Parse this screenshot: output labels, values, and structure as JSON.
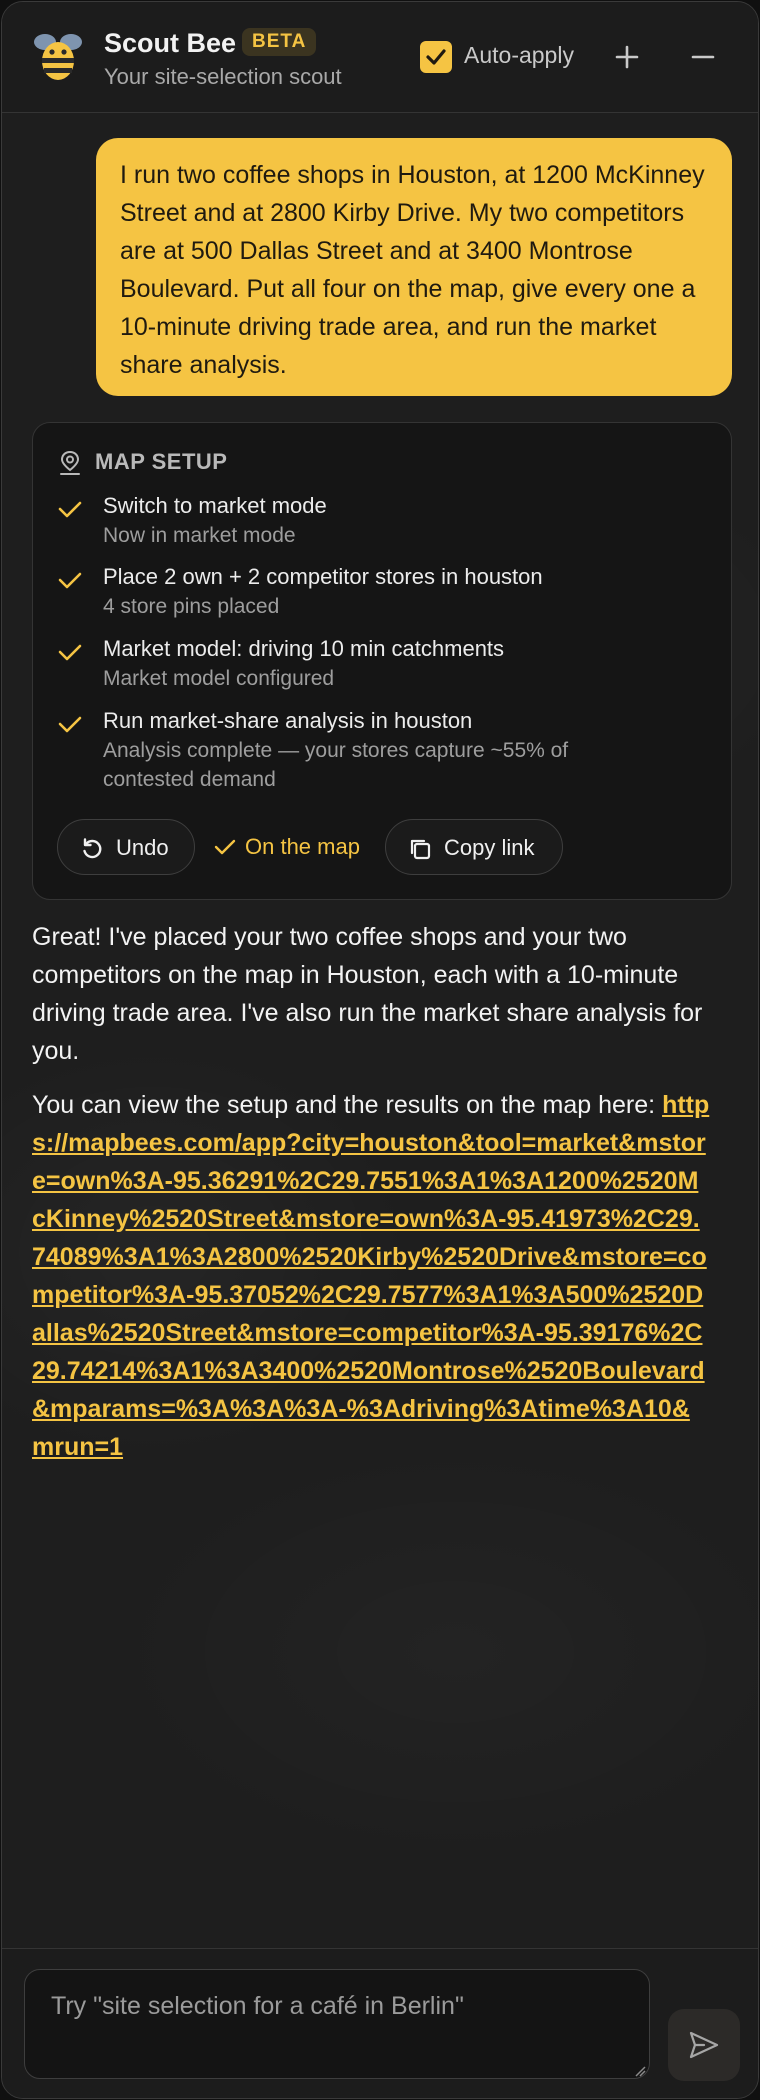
{
  "header": {
    "title": "Scout Bee",
    "badge": "BETA",
    "subtitle": "Your site-selection scout",
    "auto_apply_label": "Auto-apply",
    "auto_apply_checked": true,
    "icons": [
      "bee-logo-icon",
      "check-icon",
      "plus-icon",
      "minus-icon"
    ]
  },
  "conversation": {
    "user_message": "I run two coffee shops in Houston, at 1200 McKinney Street and at 2800 Kirby Drive. My two competitors are at 500 Dallas Street and at 3400 Montrose Boulevard. Put all four on the map, give every one a 10-minute driving trade area, and run the market share analysis.",
    "map_setup": {
      "title": "MAP SETUP",
      "steps": [
        {
          "title": "Switch to market mode",
          "detail": "Now in market mode"
        },
        {
          "title": "Place 2 own + 2 competitor stores in houston",
          "detail": "4 store pins placed"
        },
        {
          "title": "Market model: driving 10 min catchments",
          "detail": "Market model configured"
        },
        {
          "title": "Run market-share analysis in houston",
          "detail": "Analysis complete — your stores capture ~55% of contested demand"
        }
      ],
      "actions": {
        "undo": "Undo",
        "on_map": "On the map",
        "copy_link": "Copy link"
      }
    },
    "reply": {
      "paragraph_1": "Great! I've placed your two coffee shops and your two competitors on the map in Houston, each with a 10-minute driving trade area. I've also run the market share analysis for you.",
      "paragraph_2_prefix": "You can view the setup and the results on the map here:",
      "link": "https://mapbees.com/app?city=houston&tool=market&mstore=own%3A-95.36291%2C29.7551%3A1%3A1200%2520McKinney%2520Street&mstore=own%3A-95.41973%2C29.74089%3A1%3A2800%2520Kirby%2520Drive&mstore=competitor%3A-95.37052%2C29.7577%3A1%3A500%2520Dallas%2520Street&mstore=competitor%3A-95.39176%2C29.74214%3A1%3A3400%2520Montrose%2520Boulevard&mparams=%3A%3A%3A-%3Adriving%3Atime%3A10&mrun=1"
    }
  },
  "composer": {
    "placeholder": "Try \"site selection for a café in Berlin\""
  },
  "colors": {
    "accent": "#f5c443",
    "background": "#1e1e1e",
    "card_background": "#151515",
    "text": "#f3f3f3"
  }
}
